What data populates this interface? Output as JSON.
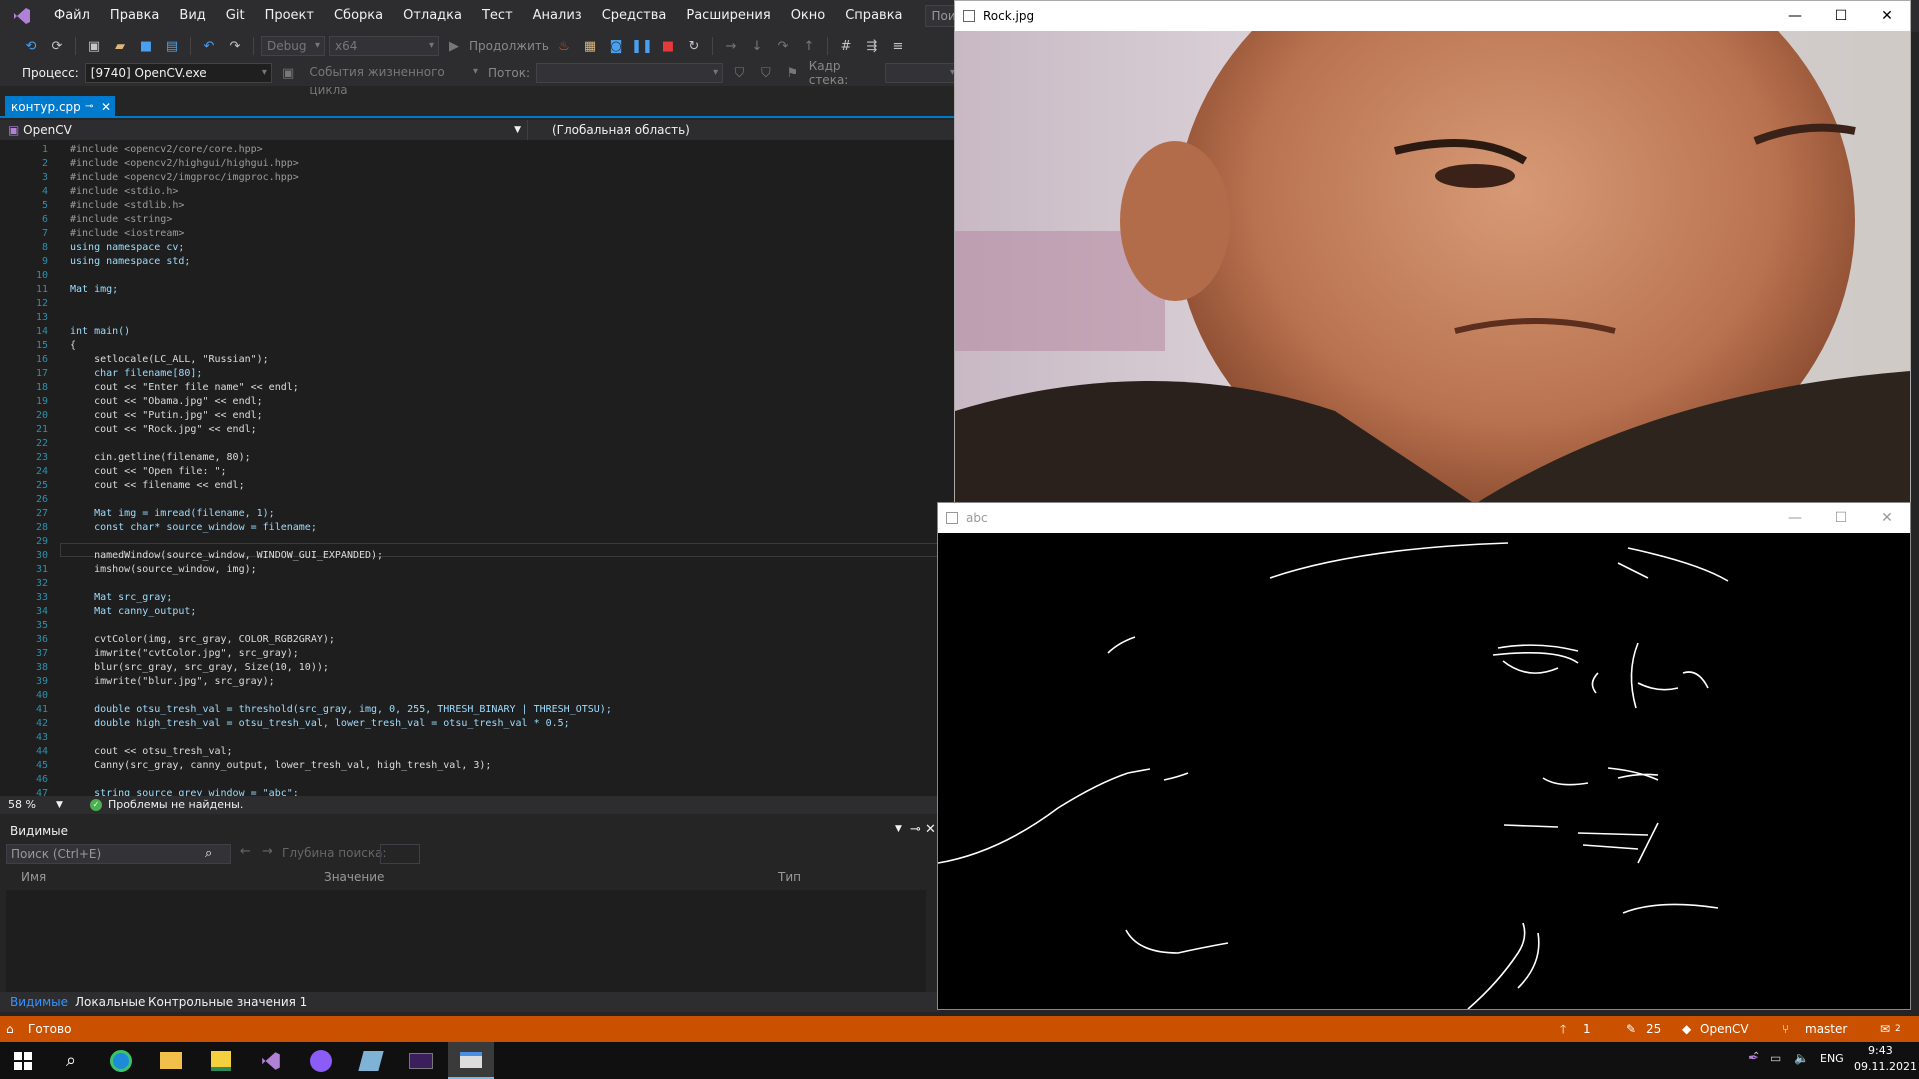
{
  "menu": [
    "Файл",
    "Правка",
    "Вид",
    "Git",
    "Проект",
    "Сборка",
    "Отладка",
    "Тест",
    "Анализ",
    "Средства",
    "Расширения",
    "Окно",
    "Справка"
  ],
  "search_placeholder": "Поиск (Ctrl+Q)",
  "toolbar": {
    "config": "Debug",
    "platform": "x64",
    "continue": "Продолжить"
  },
  "toolbar2": {
    "process_label": "Процесс:",
    "process_value": "[9740] OpenCV.exe",
    "lifecycle": "События жизненного цикла",
    "thread_label": "Поток:",
    "stack_label": "Кадр стека:"
  },
  "tab": {
    "name": "контур.cpp"
  },
  "nav": {
    "project": "OpenCV",
    "scope": "(Глобальная область)"
  },
  "code": [
    "#include <opencv2/core/core.hpp>",
    "#include <opencv2/highgui/highgui.hpp>",
    "#include <opencv2/imgproc/imgproc.hpp>",
    "#include <stdio.h>",
    "#include <stdlib.h>",
    "#include <string>",
    "#include <iostream>",
    "using namespace cv;",
    "using namespace std;",
    "",
    "Mat img;",
    "",
    "",
    "int main()",
    "{",
    "    setlocale(LC_ALL, \"Russian\");",
    "    char filename[80];",
    "    cout << \"Enter file name\" << endl;",
    "    cout << \"Obama.jpg\" << endl;",
    "    cout << \"Putin.jpg\" << endl;",
    "    cout << \"Rock.jpg\" << endl;",
    "",
    "    cin.getline(filename, 80);",
    "    cout << \"Open file: \";",
    "    cout << filename << endl;",
    "",
    "    Mat img = imread(filename, 1);",
    "    const char* source_window = filename;",
    "",
    "    namedWindow(source_window, WINDOW_GUI_EXPANDED);",
    "    imshow(source_window, img);",
    "",
    "    Mat src_gray;",
    "    Mat canny_output;",
    "",
    "    cvtColor(img, src_gray, COLOR_RGB2GRAY);",
    "    imwrite(\"cvtColor.jpg\", src_gray);",
    "    blur(src_gray, src_gray, Size(10, 10));",
    "    imwrite(\"blur.jpg\", src_gray);",
    "",
    "    double otsu_tresh_val = threshold(src_gray, img, 0, 255, THRESH_BINARY | THRESH_OTSU);",
    "    double high_tresh_val = otsu_tresh_val, lower_tresh_val = otsu_tresh_val * 0.5;",
    "",
    "    cout << otsu_tresh_val;",
    "    Canny(src_gray, canny_output, lower_tresh_val, high_tresh_val, 3);",
    "",
    "    string source_grey_window = \"abc\";"
  ],
  "editor_status": {
    "zoom": "58 %",
    "issues": "Проблемы не найдены."
  },
  "locals": {
    "title": "Видимые",
    "search": "Поиск (Ctrl+E)",
    "depth_label": "Глубина поиска:",
    "col_name": "Имя",
    "col_value": "Значение",
    "col_type": "Тип",
    "tabs": [
      "Видимые",
      "Локальные",
      "Контрольные значения 1"
    ]
  },
  "status": {
    "ready": "Готово",
    "up": "1",
    "edits": "25",
    "project": "OpenCV",
    "branch": "master",
    "notif": "2"
  },
  "tray": {
    "lang": "ENG",
    "time": "9:43",
    "date": "09.11.2021"
  },
  "rock_window": {
    "title": "Rock.jpg"
  },
  "abc_window": {
    "title": "abc"
  },
  "colors": {
    "accent": "#007acc",
    "status": "#ca5100"
  }
}
